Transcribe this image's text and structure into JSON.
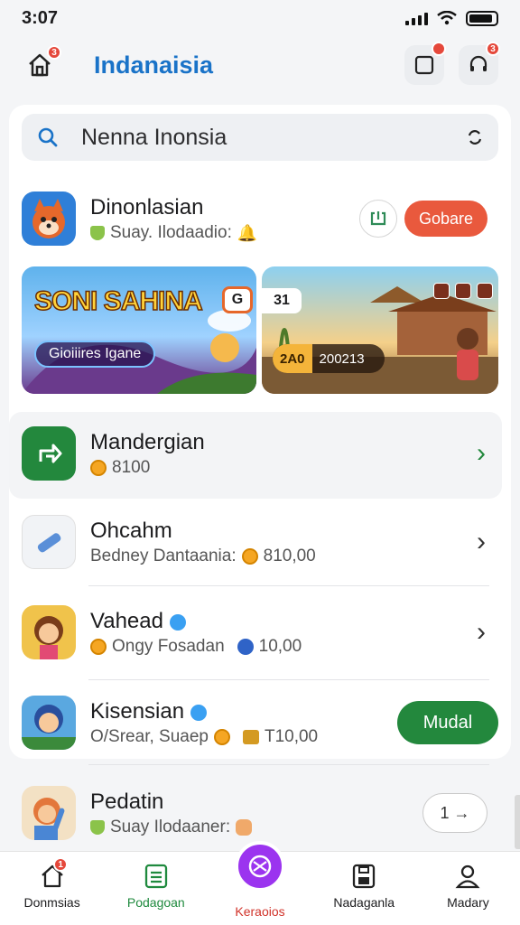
{
  "status": {
    "time": "3:07"
  },
  "header": {
    "title": "Indanaisia",
    "home_badge": "3",
    "box_badge": "",
    "support_badge": "3"
  },
  "search": {
    "placeholder": "Nenna Inonsia"
  },
  "featured": {
    "name": "Dinonlasian",
    "sub": "Suay. Ilodaadio:",
    "action": "Gobare"
  },
  "banners": {
    "left": {
      "title": "SONI SAHINA",
      "pill": "Gioiiires Igane",
      "tag": "G"
    },
    "right": {
      "top_tag": "31",
      "pill_gold": "2A0",
      "pill_value": "200213"
    }
  },
  "list": [
    {
      "name": "Mandergian",
      "sub": "8100"
    },
    {
      "name": "Ohcahm",
      "sub": "Bedney Dantaania:",
      "value": "810,00"
    },
    {
      "name": "Vahead",
      "sub": "Ongy Fosadan",
      "value": "10,00"
    },
    {
      "name": "Kisensian",
      "sub": "O/Srear, Suaep",
      "value": "T10,00",
      "action": "Mudal"
    },
    {
      "name": "Pedatin",
      "sub": "Suay Ilodaaner:",
      "action": "1 →"
    }
  ],
  "tabs": [
    {
      "label": "Donmsias",
      "badge": "1"
    },
    {
      "label": "Podagoan"
    },
    {
      "label": "Keraoios"
    },
    {
      "label": "Nadaganla"
    },
    {
      "label": "Madary"
    }
  ],
  "colors": {
    "accent": "#1a73c8",
    "green": "#23883d",
    "orange": "#e9593d",
    "purple": "#9b34ef"
  }
}
